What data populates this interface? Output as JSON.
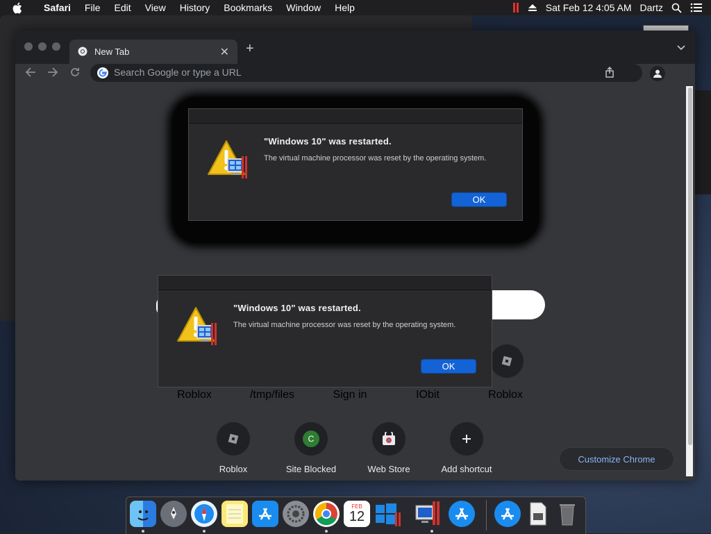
{
  "menubar": {
    "app": "Safari",
    "items": [
      "File",
      "Edit",
      "View",
      "History",
      "Bookmarks",
      "Window",
      "Help"
    ],
    "clock": "Sat Feb 12  4:05 AM",
    "user": "Dartz"
  },
  "chrome": {
    "tab_title": "New Tab",
    "omnibox_placeholder": "Search Google or type a URL",
    "shortcuts_row1": [
      "Roblox",
      "/tmp/files",
      "Sign in",
      "IObit",
      "Roblox"
    ],
    "shortcuts_row2": [
      {
        "label": "Roblox",
        "icon": "roblox-icon"
      },
      {
        "label": "Site Blocked",
        "icon": "letter-c-icon",
        "letter": "C"
      },
      {
        "label": "Web Store",
        "icon": "web-store-icon"
      },
      {
        "label": "Add shortcut",
        "icon": "plus-icon"
      }
    ],
    "customize_label": "Customize Chrome"
  },
  "dialogs": [
    {
      "title": "\"Windows 10\" was restarted.",
      "message": "The virtual machine processor was reset by the operating system.",
      "ok_label": "OK"
    },
    {
      "title": "\"Windows 10\" was restarted.",
      "message": "The virtual machine processor was reset by the operating system.",
      "ok_label": "OK"
    }
  ],
  "dock": {
    "calendar_month": "FEB",
    "calendar_day": "12"
  },
  "colors": {
    "accent_blue": "#1463d6",
    "link_blue": "#8ab4f8"
  }
}
